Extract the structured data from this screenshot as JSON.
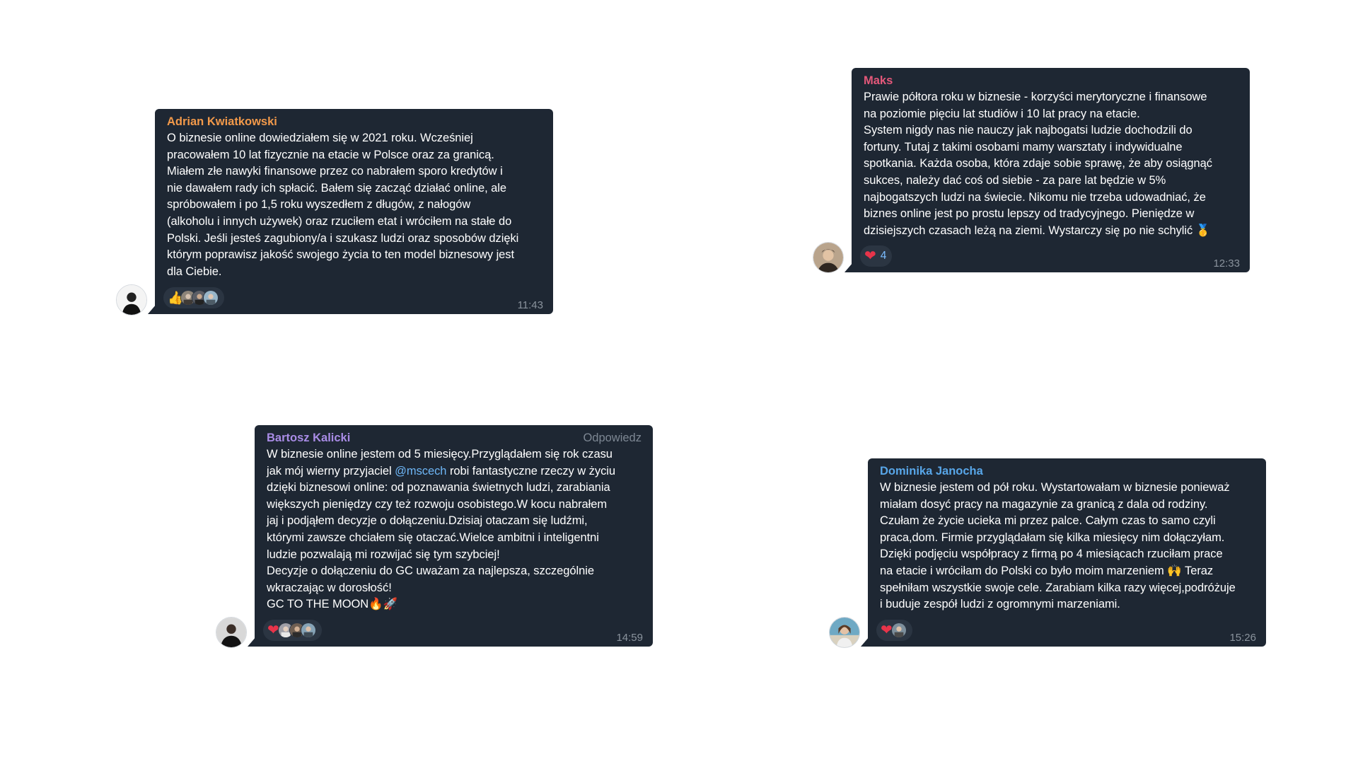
{
  "messages": [
    {
      "sender": "Adrian Kwiatkowski",
      "sender_color": "#f2994a",
      "lines": [
        "O biznesie online dowiedziałem się w 2021 roku. Wcześniej",
        "pracowałem 10 lat fizycznie na etacie w Polsce oraz za granicą.",
        "Miałem złe nawyki finansowe przez co nabrałem sporo kredytów i",
        "nie dawałem rady ich spłacić. Bałem się zacząć działać online, ale",
        "spróbowałem i po 1,5 roku wyszedłem z długów, z nałogów",
        "(alkoholu i innych używek) oraz rzuciłem etat i wróciłem na stałe do",
        "Polski. Jeśli jesteś zagubiony/a i szukasz ludzi oraz sposobów dzięki",
        "którym poprawisz jakość swojego życia to ten model biznesowy jest",
        "dla Ciebie."
      ],
      "reaction_emoji": "👍",
      "reaction_icon": "thumbs-up-icon",
      "time": "11:43"
    },
    {
      "sender": "Maks",
      "sender_color": "#e4587a",
      "lines": [
        "Prawie półtora roku w biznesie - korzyści merytoryczne i finansowe",
        "na poziomie pięciu lat studiów i 10 lat pracy na etacie.",
        "System nigdy nas nie nauczy jak najbogatsi ludzie dochodzili do",
        "fortuny. Tutaj z takimi osobami mamy warsztaty i indywidualne",
        "spotkania. Każda osoba, która zdaje sobie sprawę, że aby osiągnąć",
        "sukces, należy dać coś od siebie - za pare lat będzie w 5%",
        "najbogatszych ludzi na świecie. Nikomu nie trzeba udowadniać, że",
        "biznes online jest po prostu lepszy od tradycyjnego. Pieniędze w",
        "dzisiejszych czasach leżą na ziemi. Wystarczy się po nie schylić 🥇"
      ],
      "reaction_emoji": "❤",
      "reaction_icon": "heart-icon",
      "reaction_count": "4",
      "time": "12:33"
    },
    {
      "sender": "Bartosz Kalicki",
      "sender_color": "#a98ce6",
      "reply_label": "Odpowiedz",
      "line1": "W biznesie online jestem od 5 miesięcy.Przyglądałem się rok czasu",
      "line2_before": "jak mój wierny przyjaciel ",
      "mention": "@mscech",
      "line2_after": " robi fantastyczne rzeczy w życiu",
      "lines_rest": [
        "dzięki biznesowi online: od poznawania świetnych ludzi, zarabiania",
        "większych pieniędzy czy też rozwoju osobistego.W kocu nabrałem",
        "jaj i podjąłem decyzje o dołączeniu.Dzisiaj otaczam się ludźmi,",
        "którymi zawsze chciałem się otaczać.Wielce ambitni i inteligentni",
        "ludzie pozwalają mi rozwijać się tym szybciej!",
        "Decyzje o dołączeniu do GC uważam za najlepsza, szczególnie",
        "wkraczając w dorosłość!",
        "GC TO THE MOON🔥🚀"
      ],
      "reaction_emoji": "❤",
      "reaction_icon": "heart-icon",
      "time": "14:59"
    },
    {
      "sender": "Dominika Janocha",
      "sender_color": "#58a6e8",
      "lines": [
        "W biznesie jestem od pół roku. Wystartowałam w biznesie ponieważ",
        "miałam dosyć pracy na magazynie za granicą z dala od rodziny.",
        "Czułam że życie ucieka mi przez palce. Całym czas to samo czyli",
        "praca,dom. Firmie przyglądałam się kilka miesięcy nim dołączyłam.",
        "Dzięki podjęciu współpracy z firmą po 4 miesiącach rzuciłam prace",
        "na etacie i wróciłam do Polski co było moim marzeniem 🙌 Teraz",
        "spełniłam wszystkie swoje cele. Zarabiam kilka razy więcej,podróżuje",
        "i buduje zespół ludzi z ogromnymi marzeniami."
      ],
      "reaction_emoji": "❤",
      "reaction_icon": "heart-icon",
      "time": "15:26"
    }
  ]
}
